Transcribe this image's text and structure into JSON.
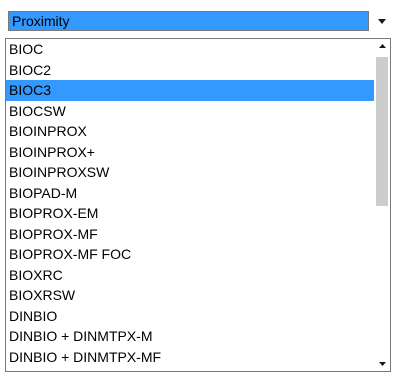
{
  "combo": {
    "selected_value": "Proximity",
    "arrow_icon": "triangle-down-icon"
  },
  "list": {
    "selected_index": 2,
    "items": [
      {
        "label": "BIOC"
      },
      {
        "label": "BIOC2"
      },
      {
        "label": "BIOC3"
      },
      {
        "label": "BIOCSW"
      },
      {
        "label": "BIOINPROX"
      },
      {
        "label": "BIOINPROX+"
      },
      {
        "label": "BIOINPROXSW"
      },
      {
        "label": "BIOPAD-M"
      },
      {
        "label": "BIOPROX-EM"
      },
      {
        "label": "BIOPROX-MF"
      },
      {
        "label": "BIOPROX-MF FOC"
      },
      {
        "label": "BIOXRC"
      },
      {
        "label": "BIOXRSW"
      },
      {
        "label": "DINBIO"
      },
      {
        "label": "DINBIO + DINMTPX-M"
      },
      {
        "label": "DINBIO + DINMTPX-MF"
      }
    ]
  },
  "scrollbar": {
    "up_icon": "scroll-up-arrow-icon",
    "down_icon": "scroll-down-arrow-icon"
  },
  "colors": {
    "selection": "#3399ff",
    "border": "#7a7a7a",
    "thumb": "#cdcdcd"
  }
}
